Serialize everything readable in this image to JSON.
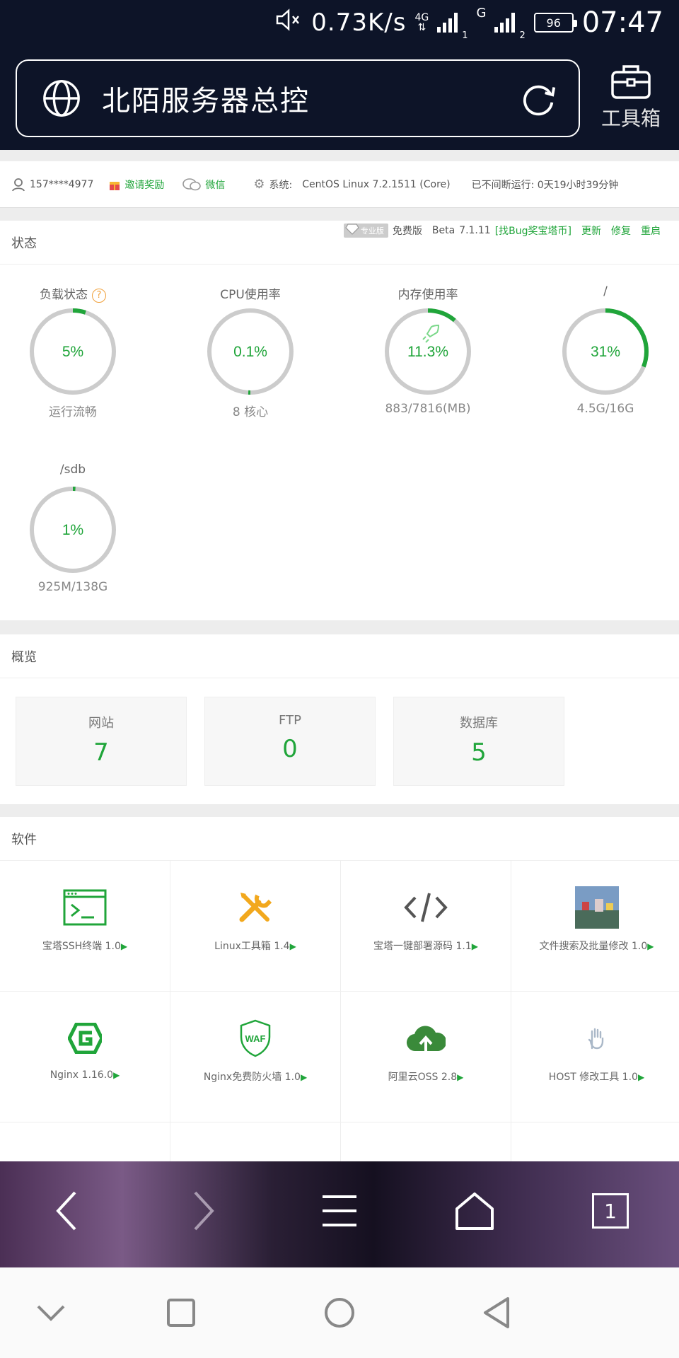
{
  "status_bar": {
    "speed": "0.73K/s",
    "net1": "4G",
    "sim1": "1",
    "net2": "G",
    "sim2": "2",
    "battery": "96",
    "time": "07:47"
  },
  "browser": {
    "title": "北陌服务器总控",
    "toolbox_label": "工具箱"
  },
  "infobar": {
    "user": "157****4977",
    "invite": "邀请奖励",
    "wechat": "微信",
    "system_label": "系统:",
    "system_value": "CentOS Linux 7.2.1511 (Core)",
    "uptime": "已不间断运行: 0天19小时39分钟"
  },
  "status_card": {
    "title": "状态",
    "pro_badge": "专业版",
    "free": "免费版",
    "beta": "Beta",
    "version": "7.1.11",
    "bug_link": "[找Bug奖宝塔币]",
    "update": "更新",
    "repair": "修复",
    "restart": "重启"
  },
  "gauges": [
    {
      "label": "负载状态",
      "value": "5%",
      "percent": 5,
      "sub": "运行流畅"
    },
    {
      "label": "CPU使用率",
      "value": "0.1%",
      "percent": 0.1,
      "sub": "8 核心"
    },
    {
      "label": "内存使用率",
      "value": "11.3%",
      "percent": 11.3,
      "sub": "883/7816(MB)"
    },
    {
      "label": "/",
      "value": "31%",
      "percent": 31,
      "sub": "4.5G/16G"
    },
    {
      "label": "/sdb",
      "value": "1%",
      "percent": 1,
      "sub": "925M/138G"
    }
  ],
  "overview": {
    "title": "概览",
    "items": [
      {
        "name": "网站",
        "count": "7"
      },
      {
        "name": "FTP",
        "count": "0"
      },
      {
        "name": "数据库",
        "count": "5"
      }
    ]
  },
  "software": {
    "title": "软件",
    "items": [
      {
        "name": "宝塔SSH终端 1.0",
        "icon": "terminal-icon"
      },
      {
        "name": "Linux工具箱 1.4",
        "icon": "tools-icon"
      },
      {
        "name": "宝塔一键部署源码 1.1",
        "icon": "code-icon"
      },
      {
        "name": "文件搜索及批量修改 1.0",
        "icon": "image-icon"
      },
      {
        "name": "Nginx 1.16.0",
        "icon": "nginx-icon"
      },
      {
        "name": "Nginx免费防火墙 1.0",
        "icon": "waf-icon"
      },
      {
        "name": "阿里云OSS 2.8",
        "icon": "cloud-upload-icon"
      },
      {
        "name": "HOST 修改工具 1.0",
        "icon": "hand-icon"
      }
    ],
    "arrow": "▶",
    "waf_text": "WAF"
  },
  "navbar": {
    "tab_count": "1"
  },
  "colors": {
    "green": "#20a53a",
    "dark": "#0d1428",
    "ring": "#cccccc"
  }
}
